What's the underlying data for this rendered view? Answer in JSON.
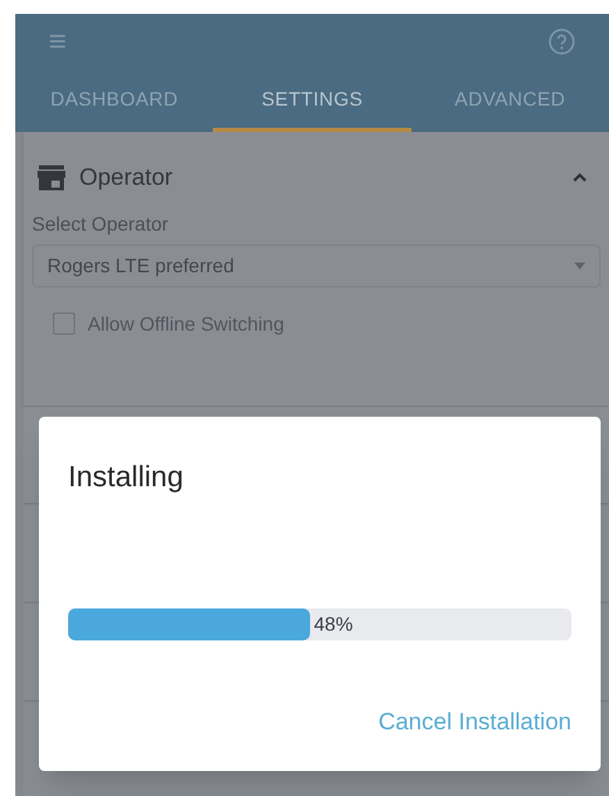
{
  "app_bar": {
    "menu_icon": "≡"
  },
  "tabs": [
    {
      "label": "DASHBOARD",
      "selected": false
    },
    {
      "label": "SETTINGS",
      "selected": true
    },
    {
      "label": "ADVANCED",
      "selected": false
    }
  ],
  "operator_card": {
    "title": "Operator",
    "expanded": true,
    "select_label": "Select Operator",
    "select_value": "Rogers LTE preferred",
    "checkbox": {
      "label": "Allow Offline Switching",
      "checked": false
    }
  },
  "dialog": {
    "title": "Installing",
    "progress": {
      "level": 0.48,
      "reading": "48%"
    },
    "action": "Cancel Installation"
  }
}
